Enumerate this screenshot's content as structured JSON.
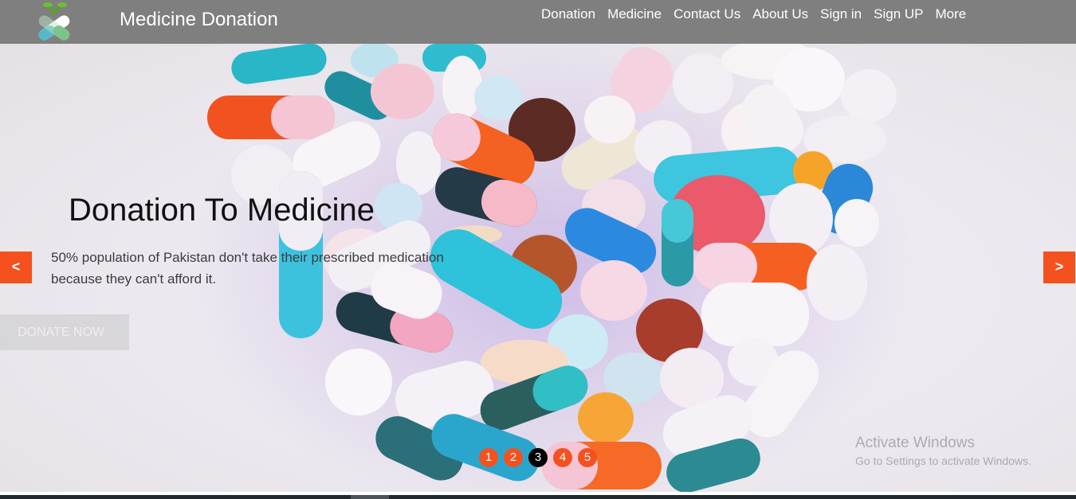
{
  "header": {
    "site_title": "Medicine Donation",
    "logo_icon": "pill-capsule-leaf-icon",
    "nav": [
      "Donation",
      "Medicine",
      "Contact Us",
      "About Us",
      "Sign in",
      "Sign UP",
      "More"
    ]
  },
  "hero": {
    "heading": "Donation To Medicine",
    "text": "50% population of Pakistan don't take their prescribed medication because they can't afford it.",
    "button_label": "DONATE NOW",
    "prev_label": "<",
    "next_label": ">",
    "slides": [
      "1",
      "2",
      "3",
      "4",
      "5"
    ],
    "active_slide": "3",
    "background_image": "heart-shaped-pills-image"
  },
  "watermark": {
    "title": "Activate Windows",
    "subtitle": "Go to Settings to activate Windows."
  },
  "colors": {
    "header_bg": "#7f7f7f",
    "accent": "#f4511e",
    "active_dot": "#000000"
  }
}
